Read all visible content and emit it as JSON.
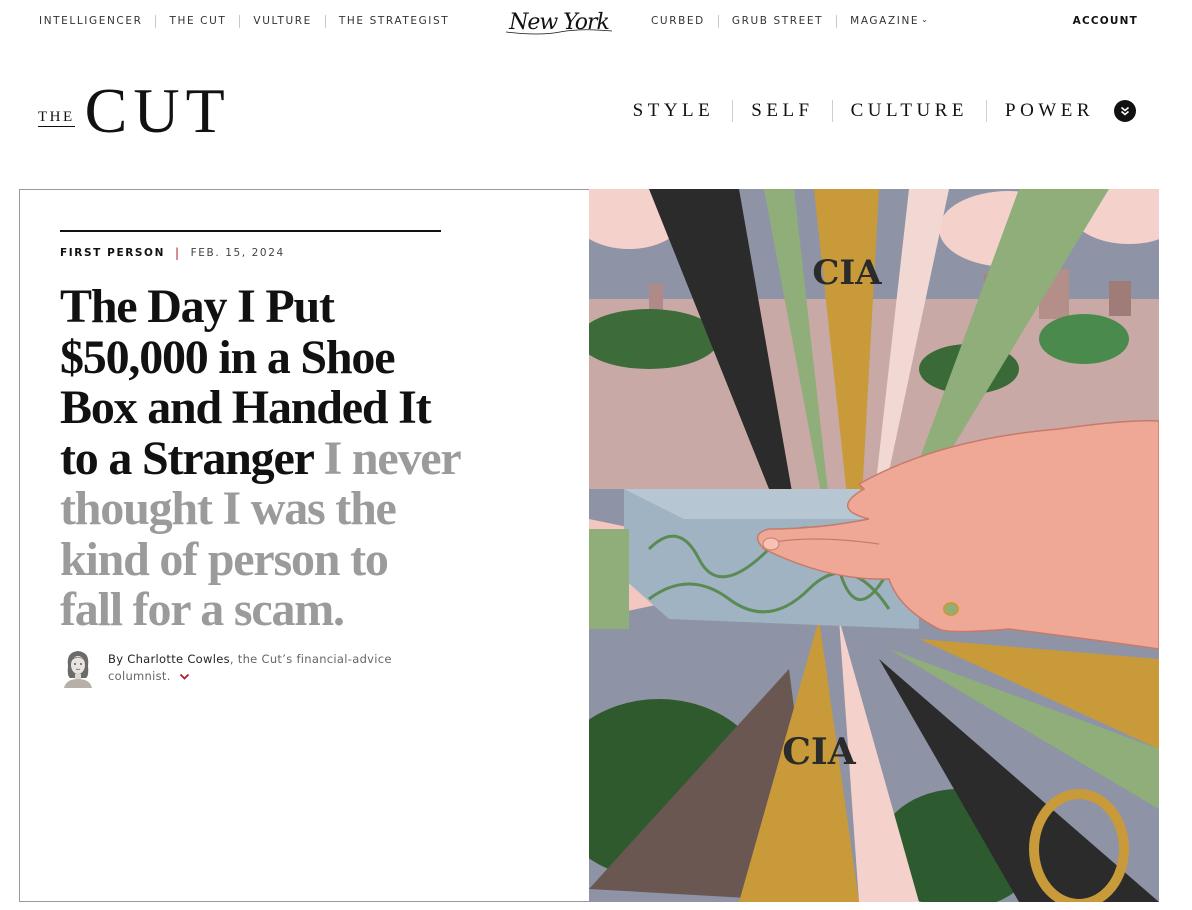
{
  "topnav": {
    "left_links": [
      "INTELLIGENCER",
      "THE CUT",
      "VULTURE",
      "THE STRATEGIST"
    ],
    "logo_text": "New York",
    "right_links": [
      "CURBED",
      "GRUB STREET",
      "MAGAZINE"
    ],
    "account": "ACCOUNT"
  },
  "masthead": {
    "logo_the": "THE",
    "logo_cut": "CUT",
    "sections": [
      "STYLE",
      "SELF",
      "CULTURE",
      "POWER"
    ],
    "more_icon": "chevron-down-circle-icon"
  },
  "article": {
    "rubric": "FIRST PERSON",
    "date": "FEB. 15, 2024",
    "headline": "The Day I Put $50,000 in a Shoe Box and Handed It to a Stranger",
    "dek": "I never thought I was the kind of person to fall for a scam.",
    "byline_prefix": "By",
    "author": "Charlotte Cowles",
    "author_desc": ", the Cut’s financial-advice columnist.",
    "hero_badge_text": "CIA"
  },
  "colors": {
    "accent_red": "#b5172b",
    "dek_gray": "#9b9b9b",
    "badge_gold": "#c99a3a",
    "money_green": "#8fae7a",
    "hand_pink": "#f0a896"
  }
}
